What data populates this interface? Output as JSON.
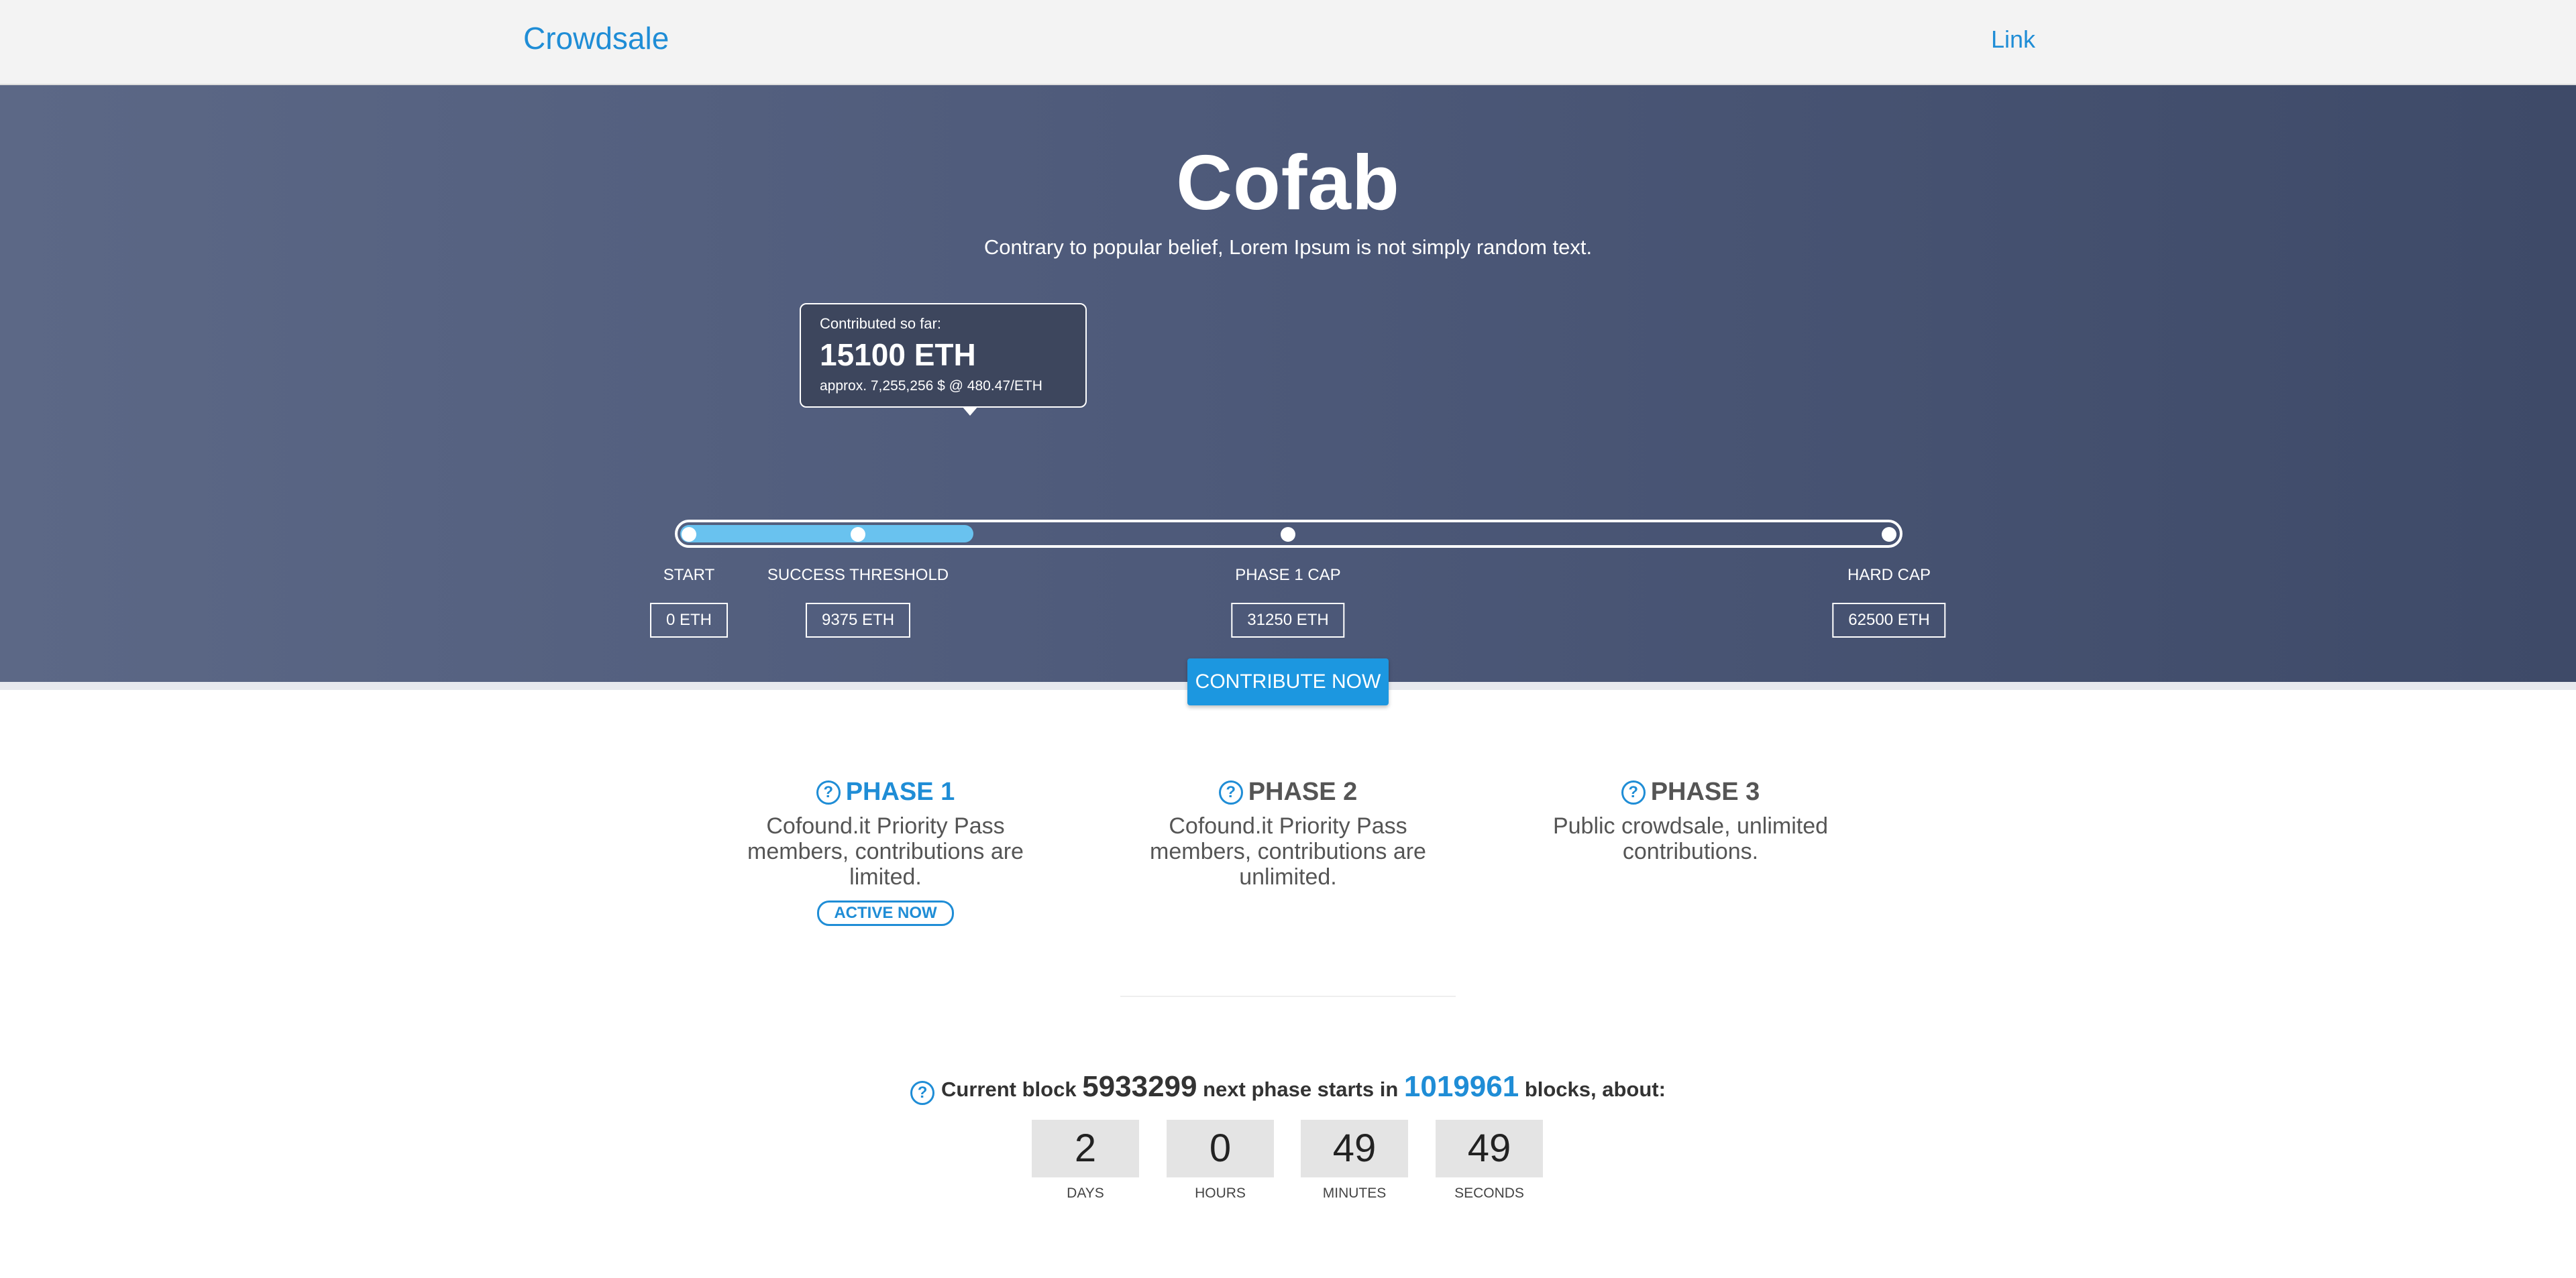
{
  "navbar": {
    "brand": "Crowdsale",
    "link": "Link"
  },
  "hero": {
    "title": "Cofab",
    "subtitle": "Contrary to popular belief, Lorem Ipsum is not simply random text.",
    "tooltip": {
      "label": "Contributed so far:",
      "amount": "15100 ETH",
      "approx": "approx. 7,255,256 $ @ 480.47/ETH"
    },
    "progress": {
      "contributed_eth": 15100,
      "hard_cap_eth": 62500
    },
    "milestones": [
      {
        "label": "START",
        "value": "0 ETH"
      },
      {
        "label": "SUCCESS THRESHOLD",
        "value": "9375 ETH"
      },
      {
        "label": "PHASE 1 CAP",
        "value": "31250 ETH"
      },
      {
        "label": "HARD CAP",
        "value": "62500 ETH"
      }
    ],
    "cta_label": "CONTRIBUTE NOW"
  },
  "phases": [
    {
      "title": "PHASE 1",
      "description": "Cofound.it Priority Pass members, contributions are limited.",
      "badge": "ACTIVE NOW",
      "active": true
    },
    {
      "title": "PHASE 2",
      "description": "Cofound.it Priority Pass members, contributions are unlimited.",
      "active": false
    },
    {
      "title": "PHASE 3",
      "description": "Public crowdsale, unlimited contributions.",
      "active": false
    }
  ],
  "blocks": {
    "prefix": "Current block",
    "current_block": "5933299",
    "middle": "next phase starts in",
    "remaining_blocks": "1019961",
    "suffix": "blocks, about:"
  },
  "countdown": [
    {
      "value": "2",
      "label": "DAYS"
    },
    {
      "value": "0",
      "label": "HOURS"
    },
    {
      "value": "49",
      "label": "MINUTES"
    },
    {
      "value": "49",
      "label": "SECONDS"
    }
  ],
  "colors": {
    "accent": "#1f8dd6",
    "progress": "#69c2ef",
    "hero_start": "#5c6886",
    "hero_end": "#3e4a68"
  },
  "icons": {
    "help": "question-circle-icon"
  }
}
